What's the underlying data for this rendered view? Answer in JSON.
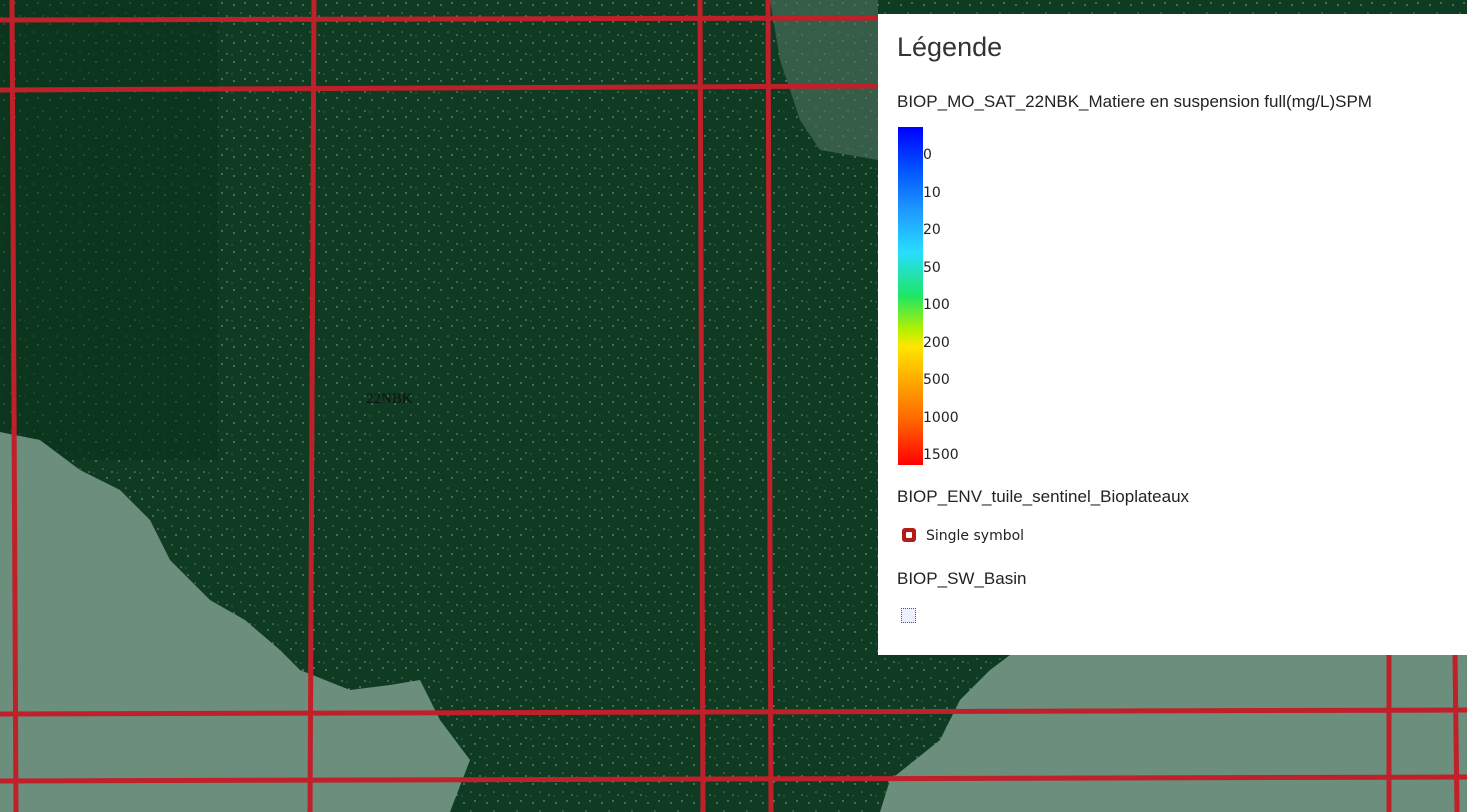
{
  "map": {
    "tile_label": "22NBK",
    "colors": {
      "forest": "#0f3b22",
      "forest_dark": "#0b311c",
      "river": "#6b8e7d",
      "grid_line": "#c0202a"
    }
  },
  "legend": {
    "title": "Légende",
    "layers": [
      {
        "name": "BIOP_MO_SAT_22NBK_Matiere en suspension full(mg/L)SPM",
        "type": "color-ramp",
        "ramp_values": [
          "0",
          "10",
          "20",
          "50",
          "100",
          "200",
          "500",
          "1000",
          "1500"
        ]
      },
      {
        "name": "BIOP_ENV_tuile_sentinel_Bioplateaux",
        "type": "symbol",
        "symbol_label": "Single symbol",
        "symbol_icon": "red-square-outline-icon"
      },
      {
        "name": "BIOP_SW_Basin",
        "type": "symbol",
        "symbol_icon": "dotted-polygon-icon"
      }
    ]
  }
}
